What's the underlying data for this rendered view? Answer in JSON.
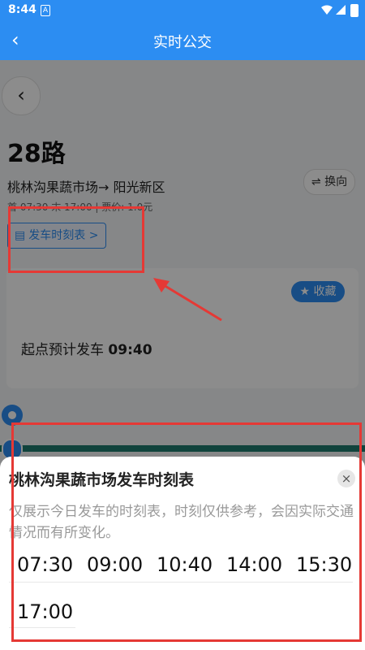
{
  "status_bar": {
    "time": "8:44",
    "sim_label": "A"
  },
  "app_bar": {
    "title": "实时公交",
    "back": "‹"
  },
  "route": {
    "number": "28路",
    "direction": "桃林沟果蔬市场→ 阳光新区",
    "switch_label": "⇌ 换向",
    "times": "首 07:30 末 17:00 | 票价: 1.0元",
    "timetable_button": "发车时刻表",
    "timetable_chevron": ">"
  },
  "card": {
    "favorite_label": "★ 收藏",
    "departure_label": "起点预计发车",
    "departure_time": "09:40"
  },
  "sheet": {
    "title": "桃林沟果蔬市场发车时刻表",
    "close": "×",
    "note": "仅展示今日发车的时刻表，时刻仅供参考，会因实际交通情况而有所变化。",
    "times": [
      "07:30",
      "09:00",
      "10:40",
      "14:00",
      "15:30",
      "17:00"
    ]
  },
  "colors": {
    "accent": "#2c8df2",
    "highlight": "#e53935",
    "line": "#1e7b6e"
  }
}
